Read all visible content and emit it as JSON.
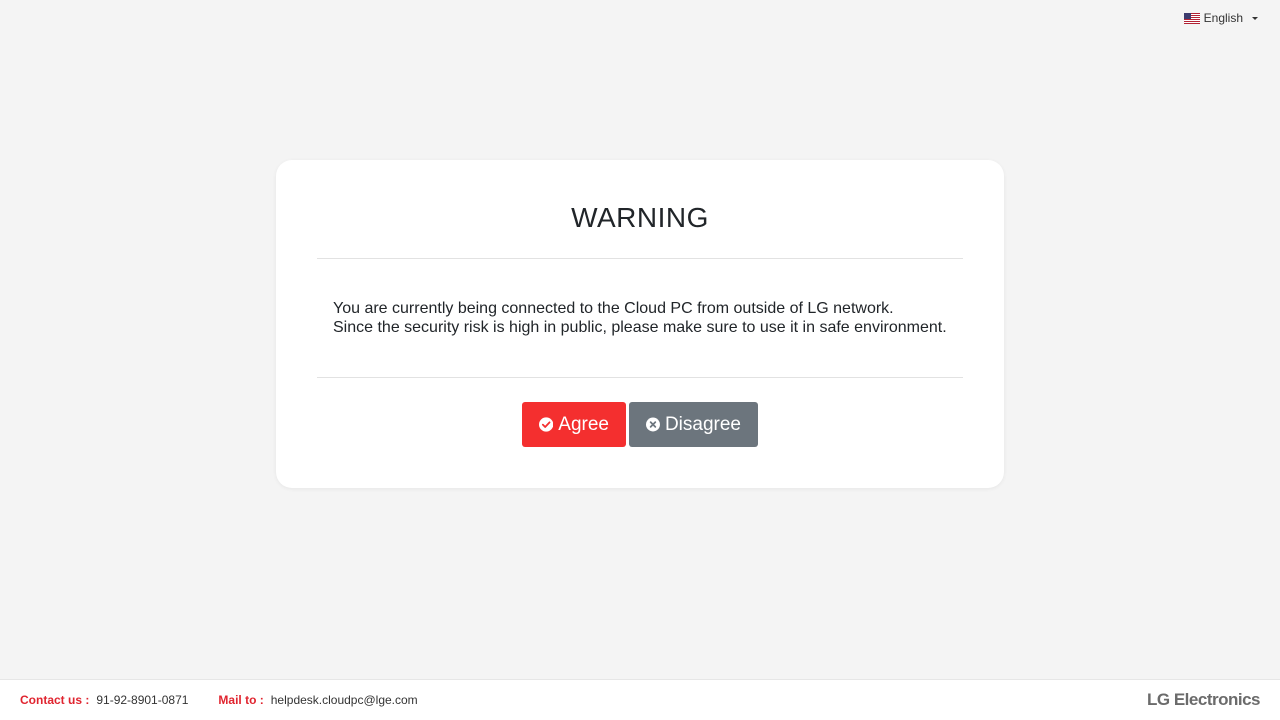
{
  "language": {
    "selected": "English"
  },
  "dialog": {
    "title": "WARNING",
    "message_line1": "You are currently being connected to the Cloud PC from outside of LG network.",
    "message_line2": "Since the security risk is high in public, please make sure to use it in safe environment.",
    "agree_label": "Agree",
    "disagree_label": "Disagree"
  },
  "footer": {
    "contact_label": "Contact us :",
    "contact_value": "91-92-8901-0871",
    "mail_label": "Mail to :",
    "mail_value": "helpdesk.cloudpc@lge.com",
    "brand": "LG Electronics"
  },
  "colors": {
    "background": "#f4f4f4",
    "agree_button": "#f42f2f",
    "disagree_button": "#6c757d",
    "footer_label": "#e0242f"
  },
  "icons": {
    "agree": "check-circle-icon",
    "disagree": "times-circle-icon",
    "language": "us-flag-icon"
  }
}
